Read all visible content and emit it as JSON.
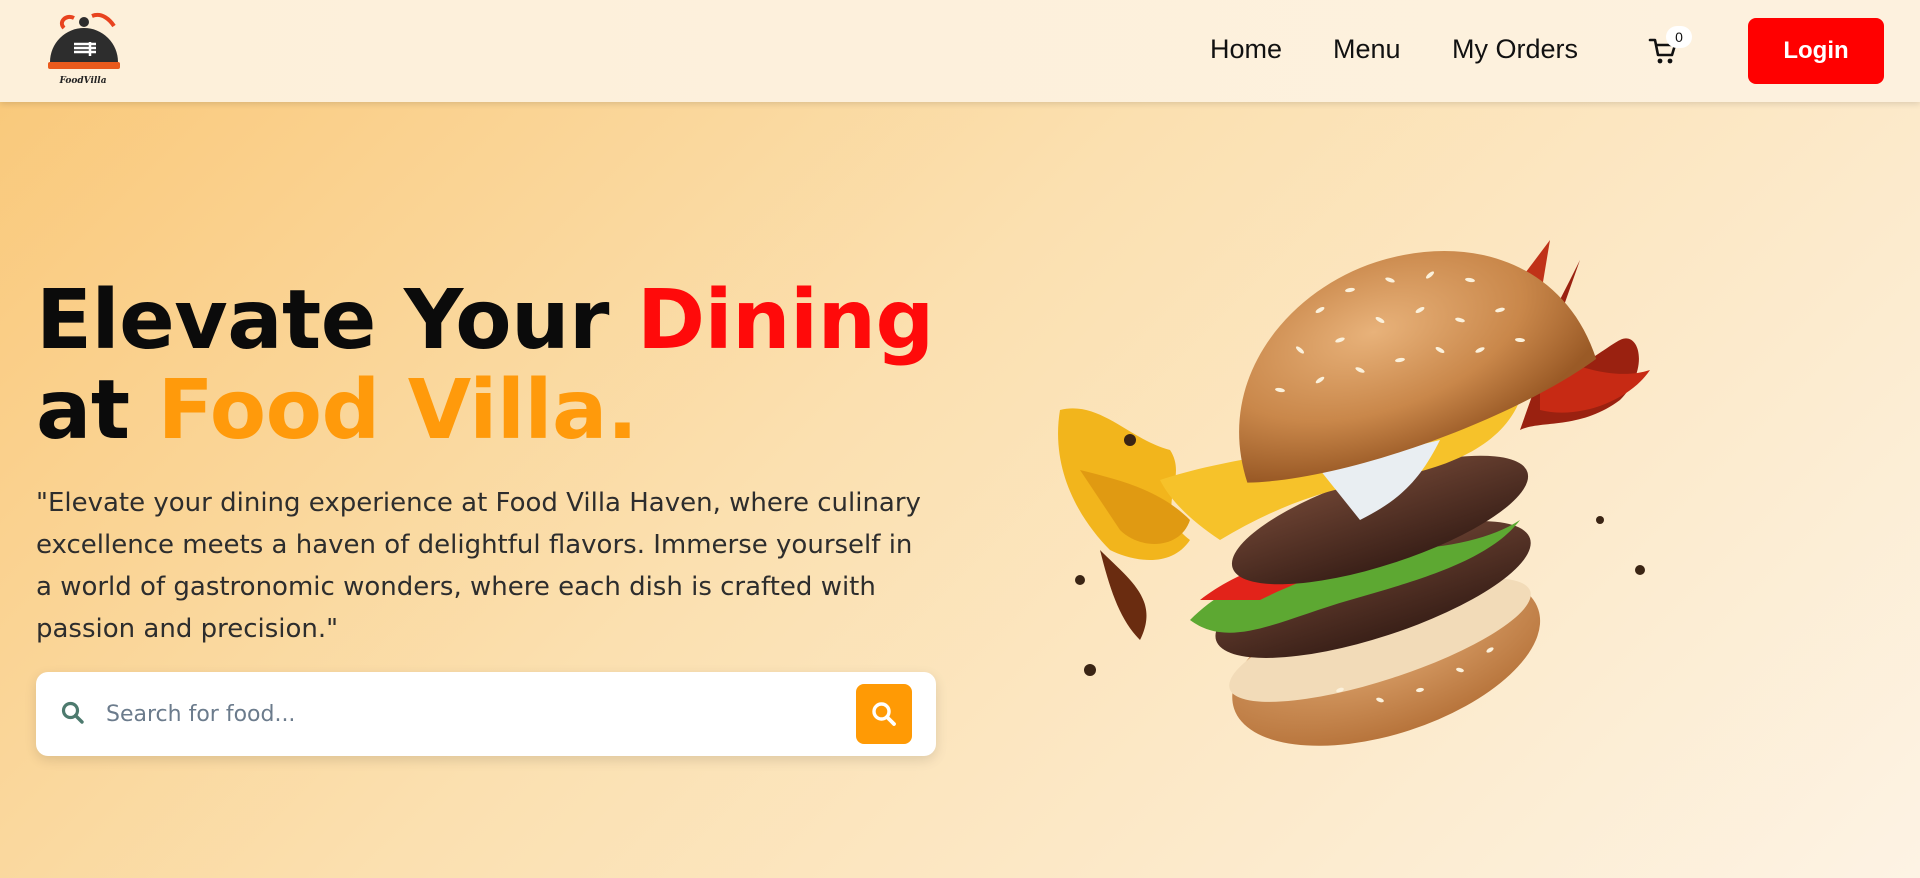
{
  "brand": {
    "logo_text": "FoodVilla",
    "accent_red": "#ff0a0a",
    "accent_orange": "#ff9a0b"
  },
  "nav": {
    "home": "Home",
    "menu": "Menu",
    "orders": "My Orders",
    "cart_icon": "cart-icon",
    "cart_count": "0",
    "login": "Login"
  },
  "hero": {
    "title_part1": "Elevate Your ",
    "title_highlight1": "Dining",
    "title_part2": "at ",
    "title_highlight2": "Food Villa.",
    "description": "\"Elevate your dining experience at Food Villa Haven, where culinary excellence meets a haven of delightful flavors. Immerse yourself in a world of gastronomic wonders, where each dish is crafted with passion and precision.\""
  },
  "search": {
    "placeholder": "Search for food...",
    "icon": "search-icon",
    "button_icon": "search-icon"
  },
  "illustration": {
    "subject": "burger-illustration"
  }
}
